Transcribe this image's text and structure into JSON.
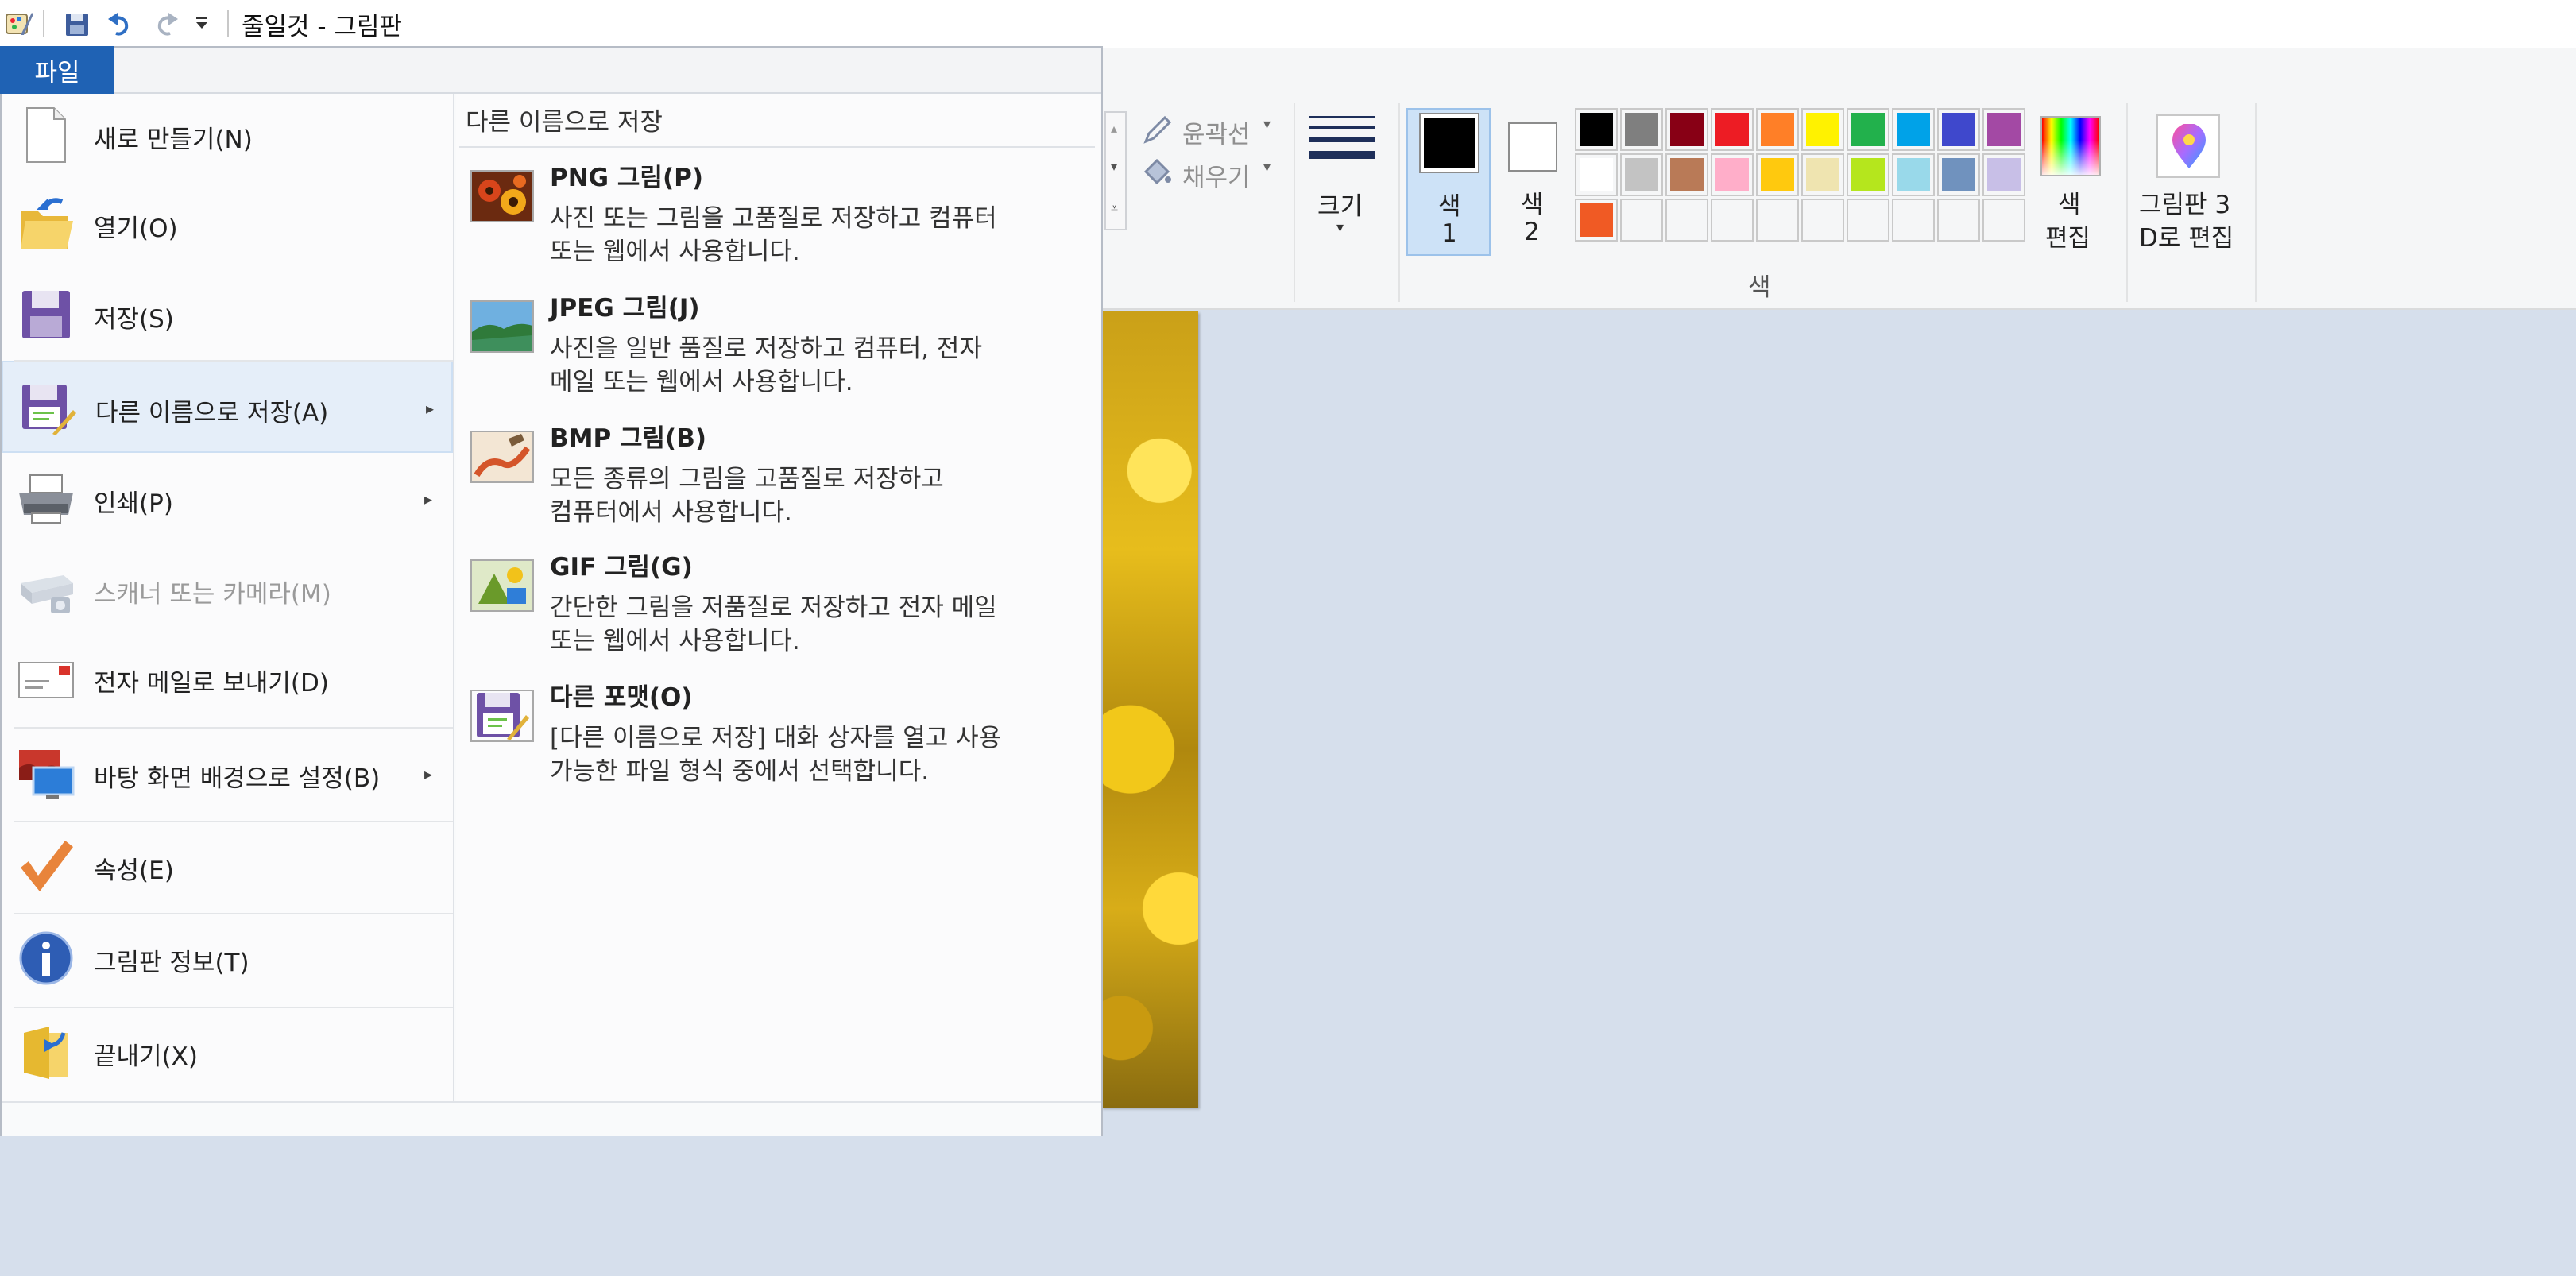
{
  "window": {
    "title": "줄일것 - 그림판"
  },
  "file_menu": {
    "tab_label": "파일",
    "items": [
      {
        "label": "새로 만들기(N)",
        "icon": "new-file-icon"
      },
      {
        "label": "열기(O)",
        "icon": "open-folder-icon"
      },
      {
        "label": "저장(S)",
        "icon": "save-disk-icon"
      },
      {
        "label": "다른 이름으로 저장(A)",
        "icon": "save-as-icon",
        "selected": true,
        "submenu": true
      },
      {
        "label": "인쇄(P)",
        "icon": "printer-icon",
        "submenu": true
      },
      {
        "label": "스캐너 또는 카메라(M)",
        "icon": "scanner-icon",
        "disabled": true
      },
      {
        "label": "전자 메일로 보내기(D)",
        "icon": "email-icon"
      },
      {
        "label": "바탕 화면 배경으로 설정(B)",
        "icon": "desktop-background-icon",
        "submenu": true
      },
      {
        "label": "속성(E)",
        "icon": "checkmark-icon"
      },
      {
        "label": "그림판 정보(T)",
        "icon": "info-icon"
      },
      {
        "label": "끝내기(X)",
        "icon": "exit-icon"
      }
    ],
    "save_as_panel": {
      "header": "다른 이름으로 저장",
      "formats": [
        {
          "title": "PNG 그림(P)",
          "desc1": "사진 또는 그림을 고품질로 저장하고 컴퓨터",
          "desc2": "또는 웹에서 사용합니다.",
          "icon": "png-flowers-icon"
        },
        {
          "title": "JPEG 그림(J)",
          "desc1": "사진을 일반 품질로 저장하고 컴퓨터, 전자",
          "desc2": "메일 또는 웹에서 사용합니다.",
          "icon": "jpeg-landscape-icon"
        },
        {
          "title": "BMP 그림(B)",
          "desc1": "모든 종류의 그림을 고품질로 저장하고",
          "desc2": "컴퓨터에서 사용합니다.",
          "icon": "bmp-brush-icon"
        },
        {
          "title": "GIF 그림(G)",
          "desc1": "간단한 그림을 저품질로 저장하고 전자 메일",
          "desc2": "또는 웹에서 사용합니다.",
          "icon": "gif-shapes-icon"
        },
        {
          "title": "다른 포맷(O)",
          "desc1": "[다른 이름으로 저장] 대화 상자를 열고 사용",
          "desc2": "가능한 파일 형식 중에서 선택합니다.",
          "icon": "other-format-icon"
        }
      ]
    }
  },
  "ribbon": {
    "outline_label": "윤곽선",
    "fill_label": "채우기",
    "size_label": "크기",
    "color1_label": "색\n1",
    "color1_line1": "색",
    "color1_line2": "1",
    "color2_line1": "색",
    "color2_line2": "2",
    "colors_group_label": "색",
    "edit_colors_line1": "색",
    "edit_colors_line2": "편집",
    "paint3d_line1": "그림판 3",
    "paint3d_line2": "D로 편집",
    "color1_value": "#000000",
    "color2_value": "#ffffff",
    "palette_row1": [
      "#000000",
      "#7f7f7f",
      "#880015",
      "#ed1c24",
      "#ff7f27",
      "#fff200",
      "#22b14c",
      "#00a2e8",
      "#3f48cc",
      "#a349a4"
    ],
    "palette_row2": [
      "#ffffff",
      "#c3c3c3",
      "#b97a57",
      "#ffaec9",
      "#ffc90e",
      "#efe4b0",
      "#b5e61d",
      "#99d9ea",
      "#7092be",
      "#c8bfe7"
    ],
    "palette_row3": [
      "#f05a24",
      "",
      "",
      "",
      "",
      "",
      "",
      "",
      "",
      ""
    ]
  }
}
